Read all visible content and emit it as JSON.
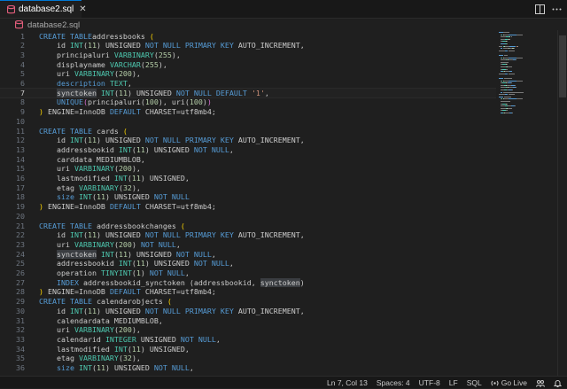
{
  "tab": {
    "title": "database2.sql",
    "close": "✕"
  },
  "breadcrumb": {
    "file": "database2.sql"
  },
  "code": [
    [
      [
        "kw",
        "CREATE TABLE"
      ],
      [
        "",
        "addressbooks "
      ],
      [
        "br1",
        "("
      ]
    ],
    [
      [
        "",
        "    id "
      ],
      [
        "tp",
        "INT"
      ],
      [
        "",
        "("
      ],
      [
        "num",
        "11"
      ],
      [
        "",
        ") UNSIGNED "
      ],
      [
        "kw",
        "NOT NULL PRIMARY KEY"
      ],
      [
        "",
        " AUTO_INCREMENT,"
      ]
    ],
    [
      [
        "",
        "    principaluri "
      ],
      [
        "tp",
        "VARBINARY"
      ],
      [
        "",
        "("
      ],
      [
        "num",
        "255"
      ],
      [
        "",
        "),"
      ]
    ],
    [
      [
        "",
        "    displayname "
      ],
      [
        "tp",
        "VARCHAR"
      ],
      [
        "",
        "("
      ],
      [
        "num",
        "255"
      ],
      [
        "",
        "),"
      ]
    ],
    [
      [
        "",
        "    uri "
      ],
      [
        "tp",
        "VARBINARY"
      ],
      [
        "",
        "("
      ],
      [
        "num",
        "200"
      ],
      [
        "",
        "),"
      ]
    ],
    [
      [
        "",
        "    "
      ],
      [
        "kw",
        "description"
      ],
      [
        "",
        " "
      ],
      [
        "tp",
        "TEXT"
      ],
      [
        "",
        ","
      ]
    ],
    [
      [
        "hl",
        "synctoken"
      ],
      [
        "",
        " "
      ],
      [
        "tp",
        "INT"
      ],
      [
        "",
        "("
      ],
      [
        "num",
        "11"
      ],
      [
        "",
        ") UNSIGNED "
      ],
      [
        "kw",
        "NOT NULL DEFAULT"
      ],
      [
        "",
        " "
      ],
      [
        "str",
        "'1'"
      ],
      [
        "",
        ","
      ]
    ],
    [
      [
        "",
        "    "
      ],
      [
        "kw",
        "UNIQUE"
      ],
      [
        "br2",
        "("
      ],
      [
        "",
        "principaluri("
      ],
      [
        "num",
        "100"
      ],
      [
        "",
        "), uri("
      ],
      [
        "num",
        "100"
      ],
      [
        "",
        ")"
      ],
      [
        "br2",
        ")"
      ]
    ],
    [
      [
        "br1",
        ")"
      ],
      [
        "",
        " ENGINE=InnoDB "
      ],
      [
        "kw",
        "DEFAULT"
      ],
      [
        "",
        " CHARSET=utf8mb4;"
      ]
    ],
    [
      [
        "",
        ""
      ]
    ],
    [
      [
        "kw",
        "CREATE TABLE"
      ],
      [
        "",
        " cards "
      ],
      [
        "br1",
        "("
      ]
    ],
    [
      [
        "",
        "    id "
      ],
      [
        "tp",
        "INT"
      ],
      [
        "",
        "("
      ],
      [
        "num",
        "11"
      ],
      [
        "",
        ") UNSIGNED "
      ],
      [
        "kw",
        "NOT NULL PRIMARY KEY"
      ],
      [
        "",
        " AUTO_INCREMENT,"
      ]
    ],
    [
      [
        "",
        "    addressbookid "
      ],
      [
        "tp",
        "INT"
      ],
      [
        "",
        "("
      ],
      [
        "num",
        "11"
      ],
      [
        "",
        ") UNSIGNED "
      ],
      [
        "kw",
        "NOT NULL"
      ],
      [
        "",
        ","
      ]
    ],
    [
      [
        "",
        "    carddata MEDIUMBLOB,"
      ]
    ],
    [
      [
        "",
        "    uri "
      ],
      [
        "tp",
        "VARBINARY"
      ],
      [
        "",
        "("
      ],
      [
        "num",
        "200"
      ],
      [
        "",
        "),"
      ]
    ],
    [
      [
        "",
        "    lastmodified "
      ],
      [
        "tp",
        "INT"
      ],
      [
        "",
        "("
      ],
      [
        "num",
        "11"
      ],
      [
        "",
        ") UNSIGNED,"
      ]
    ],
    [
      [
        "",
        "    etag "
      ],
      [
        "tp",
        "VARBINARY"
      ],
      [
        "",
        "("
      ],
      [
        "num",
        "32"
      ],
      [
        "",
        "),"
      ]
    ],
    [
      [
        "",
        "    "
      ],
      [
        "kw",
        "size"
      ],
      [
        "",
        " "
      ],
      [
        "tp",
        "INT"
      ],
      [
        "",
        "("
      ],
      [
        "num",
        "11"
      ],
      [
        "",
        ") UNSIGNED "
      ],
      [
        "kw",
        "NOT NULL"
      ]
    ],
    [
      [
        "br1",
        ")"
      ],
      [
        "",
        " ENGINE=InnoDB "
      ],
      [
        "kw",
        "DEFAULT"
      ],
      [
        "",
        " CHARSET=utf8mb4;"
      ]
    ],
    [
      [
        "",
        ""
      ]
    ],
    [
      [
        "kw",
        "CREATE TABLE"
      ],
      [
        "",
        " addressbookchanges "
      ],
      [
        "br1",
        "("
      ]
    ],
    [
      [
        "",
        "    id "
      ],
      [
        "tp",
        "INT"
      ],
      [
        "",
        "("
      ],
      [
        "num",
        "11"
      ],
      [
        "",
        ") UNSIGNED "
      ],
      [
        "kw",
        "NOT NULL PRIMARY KEY"
      ],
      [
        "",
        " AUTO_INCREMENT,"
      ]
    ],
    [
      [
        "",
        "    uri "
      ],
      [
        "tp",
        "VARBINARY"
      ],
      [
        "",
        "("
      ],
      [
        "num",
        "200"
      ],
      [
        "",
        ") "
      ],
      [
        "kw",
        "NOT NULL"
      ],
      [
        "",
        ","
      ]
    ],
    [
      [
        "",
        "    "
      ],
      [
        "hl",
        "synctoken"
      ],
      [
        "",
        " "
      ],
      [
        "tp",
        "INT"
      ],
      [
        "",
        "("
      ],
      [
        "num",
        "11"
      ],
      [
        "",
        ") UNSIGNED "
      ],
      [
        "kw",
        "NOT NULL"
      ],
      [
        "",
        ","
      ]
    ],
    [
      [
        "",
        "    addressbookid "
      ],
      [
        "tp",
        "INT"
      ],
      [
        "",
        "("
      ],
      [
        "num",
        "11"
      ],
      [
        "",
        ") UNSIGNED "
      ],
      [
        "kw",
        "NOT NULL"
      ],
      [
        "",
        ","
      ]
    ],
    [
      [
        "",
        "    operation "
      ],
      [
        "tp",
        "TINYINT"
      ],
      [
        "",
        "("
      ],
      [
        "num",
        "1"
      ],
      [
        "",
        ") "
      ],
      [
        "kw",
        "NOT NULL"
      ],
      [
        "",
        ","
      ]
    ],
    [
      [
        "",
        "    "
      ],
      [
        "kw",
        "INDEX"
      ],
      [
        "",
        " addressbookid_synctoken (addressbookid, "
      ],
      [
        "hl",
        "synctoken"
      ],
      [
        "",
        ")"
      ]
    ],
    [
      [
        "br1",
        ")"
      ],
      [
        "",
        " ENGINE=InnoDB "
      ],
      [
        "kw",
        "DEFAULT"
      ],
      [
        "",
        " CHARSET=utf8mb4;"
      ]
    ],
    [
      [
        "kw",
        "CREATE TABLE"
      ],
      [
        "",
        " calendarobjects "
      ],
      [
        "br1",
        "("
      ]
    ],
    [
      [
        "",
        "    id "
      ],
      [
        "tp",
        "INT"
      ],
      [
        "",
        "("
      ],
      [
        "num",
        "11"
      ],
      [
        "",
        ") UNSIGNED "
      ],
      [
        "kw",
        "NOT NULL PRIMARY KEY"
      ],
      [
        "",
        " AUTO_INCREMENT,"
      ]
    ],
    [
      [
        "",
        "    calendardata MEDIUMBLOB,"
      ]
    ],
    [
      [
        "",
        "    uri "
      ],
      [
        "tp",
        "VARBINARY"
      ],
      [
        "",
        "("
      ],
      [
        "num",
        "200"
      ],
      [
        "",
        "),"
      ]
    ],
    [
      [
        "",
        "    calendarid "
      ],
      [
        "tp",
        "INTEGER"
      ],
      [
        "",
        " UNSIGNED "
      ],
      [
        "kw",
        "NOT NULL"
      ],
      [
        "",
        ","
      ]
    ],
    [
      [
        "",
        "    lastmodified "
      ],
      [
        "tp",
        "INT"
      ],
      [
        "",
        "("
      ],
      [
        "num",
        "11"
      ],
      [
        "",
        ") UNSIGNED,"
      ]
    ],
    [
      [
        "",
        "    etag "
      ],
      [
        "tp",
        "VARBINARY"
      ],
      [
        "",
        "("
      ],
      [
        "num",
        "32"
      ],
      [
        "",
        "),"
      ]
    ],
    [
      [
        "",
        "    "
      ],
      [
        "kw",
        "size"
      ],
      [
        "",
        " "
      ],
      [
        "tp",
        "INT"
      ],
      [
        "",
        "("
      ],
      [
        "num",
        "11"
      ],
      [
        "",
        ") UNSIGNED "
      ],
      [
        "kw",
        "NOT NULL"
      ],
      [
        "",
        ","
      ]
    ]
  ],
  "editor": {
    "current_line": 7
  },
  "status": {
    "position": "Ln 7, Col 13",
    "indent": "Spaces: 4",
    "encoding": "UTF-8",
    "eol": "LF",
    "language": "SQL",
    "go_live": "Go Live"
  },
  "colors": {
    "accent": "#0078d4",
    "keyword": "#569cd6",
    "type": "#4ec9b0",
    "number": "#b5cea8",
    "string": "#ce9178"
  }
}
